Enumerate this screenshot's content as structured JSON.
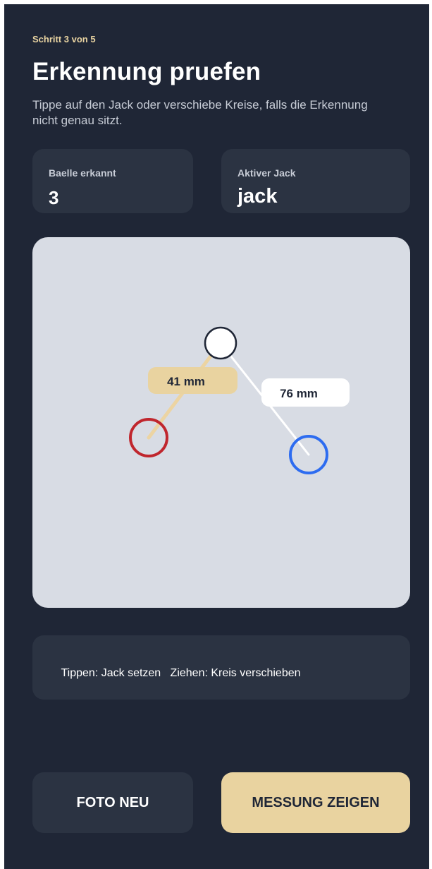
{
  "header": {
    "step": "Schritt 3 von 5",
    "title": "Erkennung pruefen",
    "subtitle": "Tippe auf den Jack oder verschiebe Kreise, falls die Erkennung nicht genau sitzt."
  },
  "stats": {
    "balls_label": "Baelle erkannt",
    "balls_value": "3",
    "jack_label": "Aktiver Jack",
    "jack_value": "jack"
  },
  "canvas": {
    "balls": [
      {
        "name": "jack",
        "color": "#ffffff",
        "stroke": "#1f2636"
      },
      {
        "name": "red-ball",
        "color": "#c0262d"
      },
      {
        "name": "blue-ball",
        "color": "#2d6cf0"
      }
    ],
    "distances": [
      {
        "label": "41 mm",
        "badge_color": "#e9d3a0",
        "line_color": "#ecd4a2"
      },
      {
        "label": "76 mm",
        "badge_color": "#ffffff",
        "line_color": "#ffffff"
      }
    ]
  },
  "hint": {
    "text": "Tippen: Jack setzen   Ziehen: Kreis verschieben"
  },
  "actions": {
    "retake_label": "FOTO NEU",
    "show_label": "MESSUNG ZEIGEN"
  }
}
